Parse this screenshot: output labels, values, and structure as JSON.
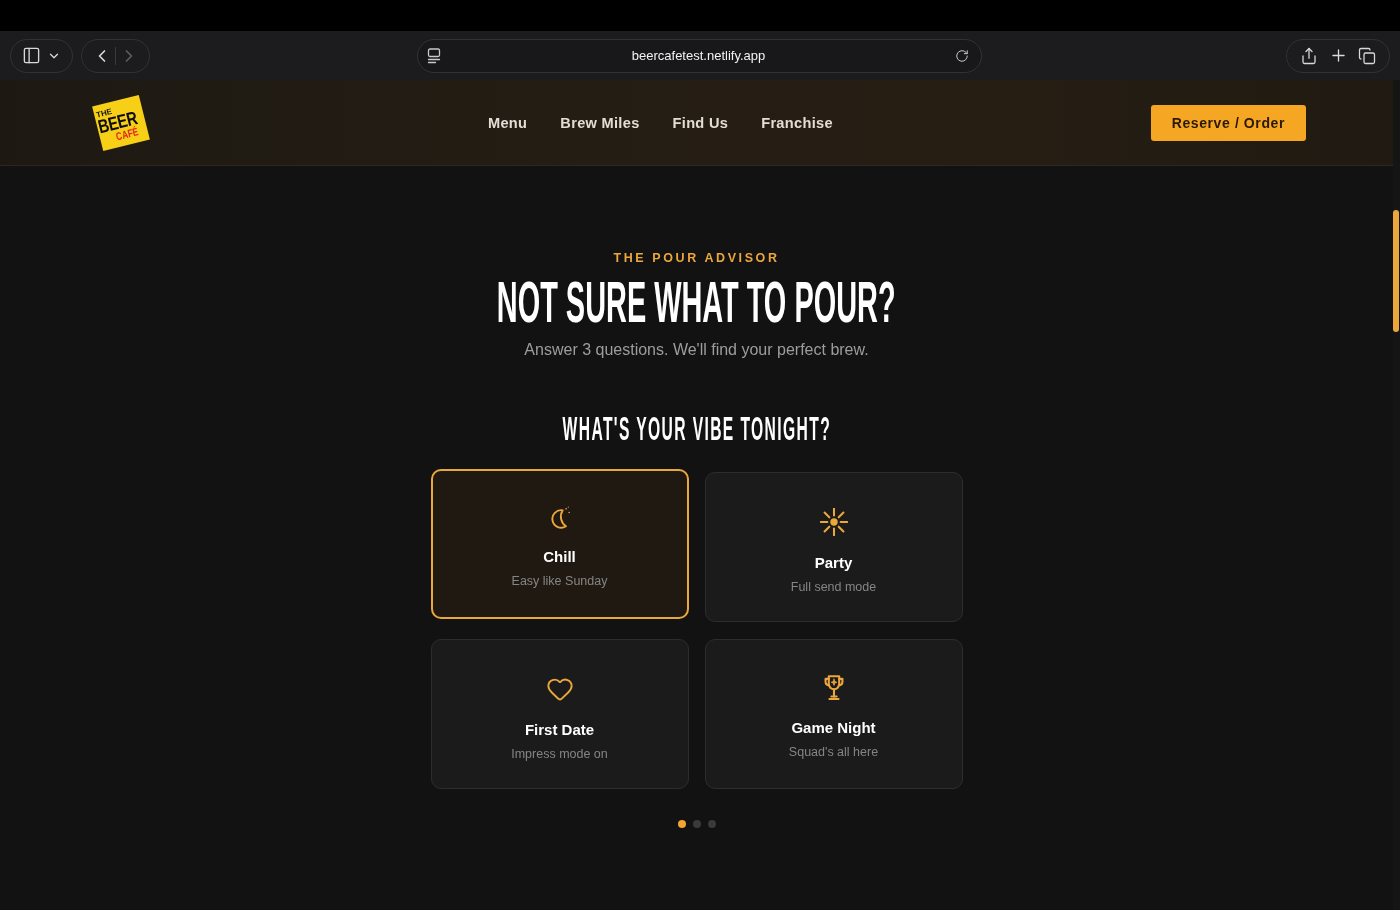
{
  "browser": {
    "url": "beercafetest.netlify.app",
    "back": {
      "disabled": false
    },
    "forward": {
      "disabled": true
    }
  },
  "header": {
    "logo": {
      "top": "THE",
      "main": "BEER",
      "bottom": "CAFÉ"
    },
    "nav": [
      "Menu",
      "Brew Miles",
      "Find Us",
      "Franchise"
    ],
    "cta": "Reserve / Order"
  },
  "advisor": {
    "eyebrow": "THE POUR ADVISOR",
    "title": "NOT SURE WHAT TO POUR?",
    "subtitle": "Answer 3 questions. We'll find your perfect brew.",
    "question": "WHAT'S YOUR VIBE TONIGHT?",
    "options": [
      {
        "label": "Chill",
        "description": "Easy like Sunday",
        "selected": true
      },
      {
        "label": "Party",
        "description": "Full send mode",
        "selected": false
      },
      {
        "label": "First Date",
        "description": "Impress mode on",
        "selected": false
      },
      {
        "label": "Game Night",
        "description": "Squad's all here",
        "selected": false
      }
    ],
    "steps": [
      {
        "selected": true
      },
      {
        "selected": false
      },
      {
        "selected": false
      }
    ]
  }
}
